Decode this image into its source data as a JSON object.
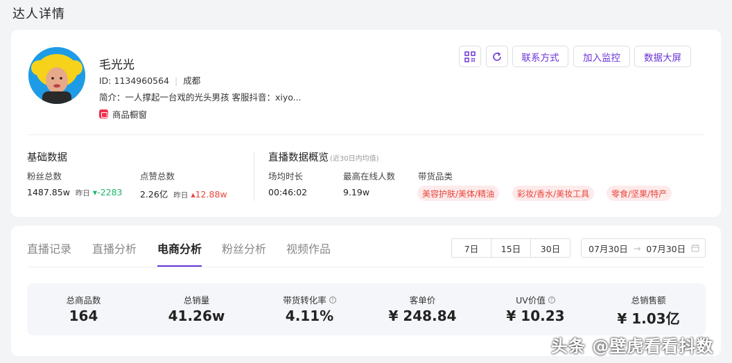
{
  "page": {
    "title": "达人详情"
  },
  "profile": {
    "name": "毛光光",
    "id_text": "ID: 1134960564",
    "location": "成都",
    "intro": "简介：一人撑起一台戏的光头男孩 客服抖音：xiyo...",
    "shop_label": "商品橱窗"
  },
  "actions": {
    "qr_icon": "qr-code-icon",
    "refresh_icon": "refresh-icon",
    "contact": "联系方式",
    "monitor": "加入监控",
    "big_screen": "数据大屏",
    "accent_color": "#6a34d6"
  },
  "basic": {
    "title": "基础数据",
    "fans_label": "粉丝总数",
    "fans_value": "1487.85w",
    "fans_yesterday": "昨日",
    "fans_change": "-2283",
    "likes_label": "点赞总数",
    "likes_value": "2.26亿",
    "likes_yesterday": "昨日",
    "likes_change": "12.88w"
  },
  "live": {
    "title": "直播数据概览",
    "note": "(近30日内均值)",
    "duration_label": "场均时长",
    "duration_value": "00:46:02",
    "peak_label": "最高在线人数",
    "peak_value": "9.19w",
    "category_label": "带货品类",
    "categories": [
      "美容护肤/美体/精油",
      "彩妆/香水/美妆工具",
      "零食/坚果/特产"
    ]
  },
  "tabs": {
    "items": [
      "直播记录",
      "直播分析",
      "电商分析",
      "粉丝分析",
      "视频作品"
    ],
    "active": "电商分析"
  },
  "range": {
    "options": [
      "7日",
      "15日",
      "30日"
    ]
  },
  "date_range": {
    "start": "07月30日",
    "end": "07月30日"
  },
  "stats": [
    {
      "label": "总商品数",
      "value": "164",
      "help": false
    },
    {
      "label": "总销量",
      "value": "41.26w",
      "help": false
    },
    {
      "label": "带货转化率",
      "value": "4.11%",
      "help": true
    },
    {
      "label": "客单价",
      "value": "¥ 248.84",
      "help": false
    },
    {
      "label": "UV价值",
      "value": "¥ 10.23",
      "help": true
    },
    {
      "label": "总销售额",
      "value": "¥ 1.03亿",
      "help": false
    }
  ],
  "watermark": "头条 @壁虎看看抖数"
}
